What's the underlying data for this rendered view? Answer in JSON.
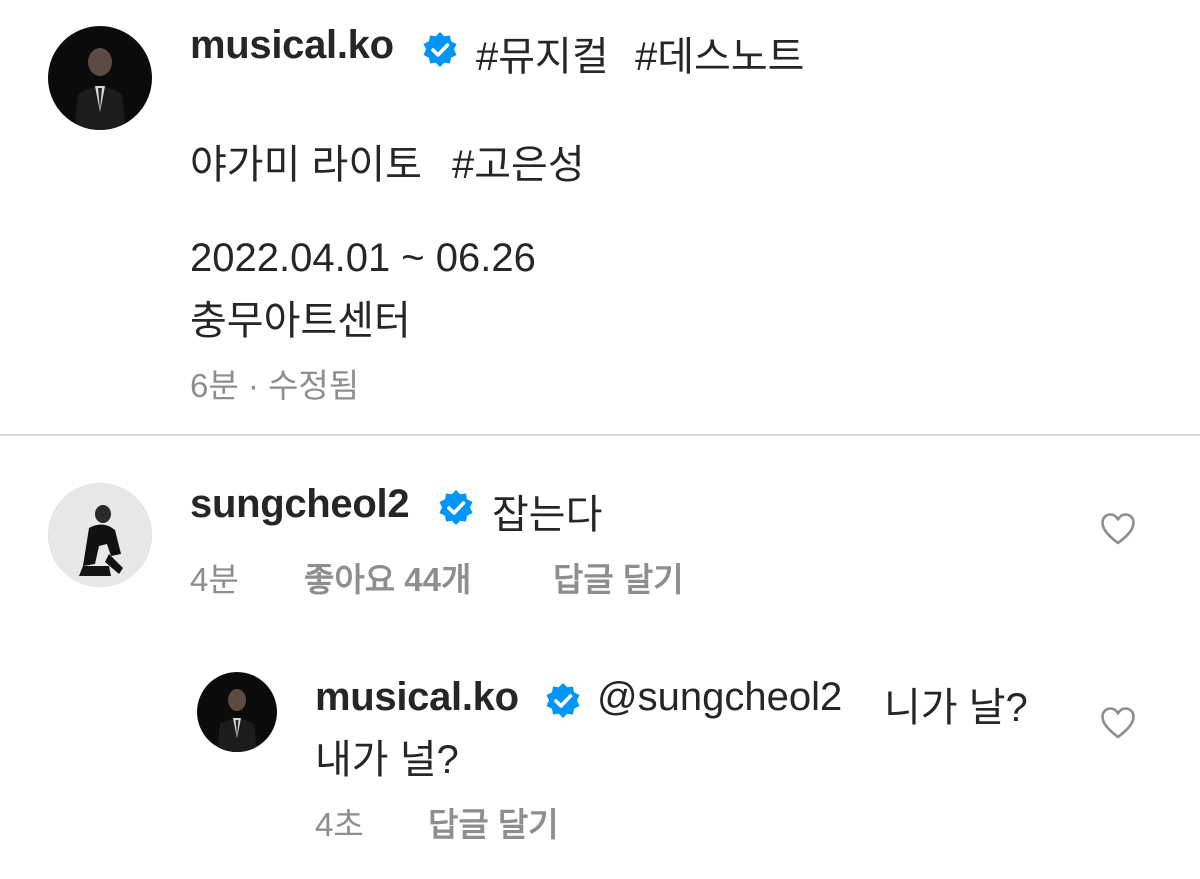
{
  "post": {
    "username": "musical.ko",
    "verified_icon": "verified-badge-icon",
    "hashtags_inline": [
      "#뮤지컬",
      "#데스노트"
    ],
    "caption_line1_text": "야가미 라이토",
    "caption_line1_hashtag": "#고은성",
    "caption_dates": "2022.04.01 ~ 06.26",
    "caption_venue": "충무아트센터",
    "meta": "6분 · 수정됨"
  },
  "comments": [
    {
      "username": "sungcheol2",
      "text": "잡는다",
      "time": "4분",
      "likes": "좋아요 44개",
      "reply_label": "답글 달기",
      "like_icon": "heart-outline-icon"
    },
    {
      "username": "musical.ko",
      "mention": "@sungcheol2",
      "text_line1": "니가 날?",
      "text_line2": "내가 널?",
      "time": "4초",
      "reply_label": "답글 달기",
      "like_icon": "heart-outline-icon"
    }
  ],
  "colors": {
    "text": "#262626",
    "hashtag": "#00376b",
    "verified": "#0095f6",
    "meta": "#8e8e8e",
    "divider": "#dbdbdb"
  }
}
